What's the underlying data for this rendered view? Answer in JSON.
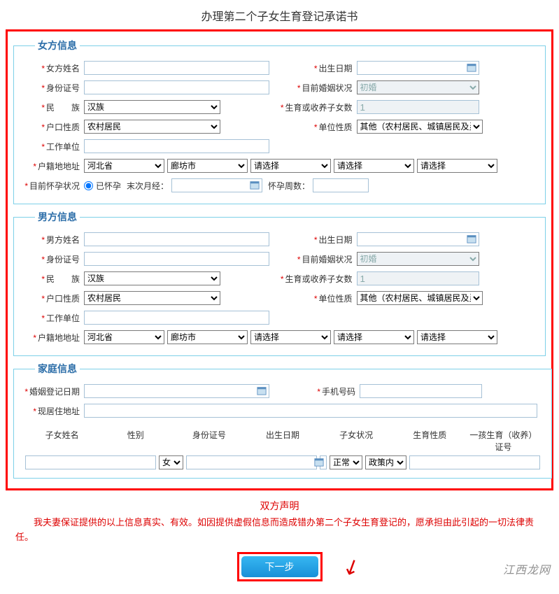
{
  "title": "办理第二个子女生育登记承诺书",
  "female": {
    "legend": "女方信息",
    "name_label": "女方姓名",
    "birth_label": "出生日期",
    "id_label": "身份证号",
    "marital_label": "目前婚姻状况",
    "marital_value": "初婚",
    "ethnic_label": "民　　族",
    "ethnic_value": "汉族",
    "children_count_label": "生育或收养子女数",
    "children_count_value": "1",
    "hukou_type_label": "户口性质",
    "hukou_type_value": "农村居民",
    "unit_type_label": "单位性质",
    "unit_type_value": "其他（农村居民、城镇居民及灵",
    "work_unit_label": "工作单位",
    "hukou_addr_label": "户籍地地址",
    "addr_province": "河北省",
    "addr_city": "廊坊市",
    "addr_placeholder": "请选择",
    "preg_status_label": "目前怀孕状况",
    "pregnant_option": "已怀孕",
    "last_period_label": "末次月经：",
    "preg_weeks_label": "怀孕周数："
  },
  "male": {
    "legend": "男方信息",
    "name_label": "男方姓名",
    "birth_label": "出生日期",
    "id_label": "身份证号",
    "marital_label": "目前婚姻状况",
    "marital_value": "初婚",
    "ethnic_label": "民　　族",
    "ethnic_value": "汉族",
    "children_count_label": "生育或收养子女数",
    "children_count_value": "1",
    "hukou_type_label": "户口性质",
    "hukou_type_value": "农村居民",
    "unit_type_label": "单位性质",
    "unit_type_value": "其他（农村居民、城镇居民及灵",
    "work_unit_label": "工作单位",
    "hukou_addr_label": "户籍地地址",
    "addr_province": "河北省",
    "addr_city": "廊坊市",
    "addr_placeholder": "请选择"
  },
  "family": {
    "legend": "家庭信息",
    "marriage_reg_label": "婚姻登记日期",
    "phone_label": "手机号码",
    "residence_label": "现居住地址",
    "child_headers": {
      "name": "子女姓名",
      "gender": "性别",
      "id": "身份证号",
      "birth": "出生日期",
      "status": "子女状况",
      "nature": "生育性质",
      "cert": "一孩生育（收养）证号"
    },
    "gender_value": "女",
    "status_value": "正常",
    "nature_value": "政策内"
  },
  "declaration": {
    "title": "双方声明",
    "text": "我夫妻保证提供的以上信息真实、有效。如因提供虚假信息而造成错办第二个子女生育登记的，愿承担由此引起的一切法律责任。"
  },
  "next_button": "下一步",
  "watermark": "江西龙网"
}
